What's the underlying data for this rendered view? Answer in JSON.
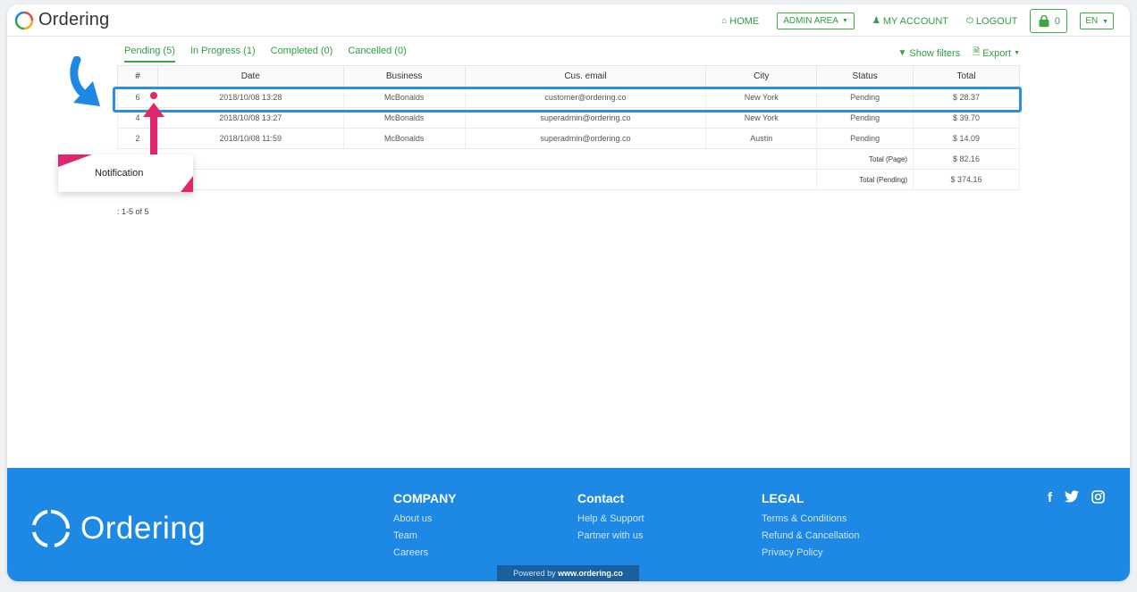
{
  "header": {
    "logo_text": "Ordering",
    "nav": {
      "home": "HOME",
      "admin_area": "ADMIN AREA",
      "my_account": "MY ACCOUNT",
      "logout": "LOGOUT",
      "cart_count": "0",
      "lang": "EN"
    }
  },
  "tabs": [
    {
      "label": "Pending (5)"
    },
    {
      "label": "In Progress (1)"
    },
    {
      "label": "Completed (0)"
    },
    {
      "label": "Cancelled (0)"
    }
  ],
  "tools": {
    "show_filters": "Show filters",
    "export": "Export"
  },
  "table": {
    "columns": [
      "#",
      "Date",
      "Business",
      "Cus. email",
      "City",
      "Status",
      "Total"
    ],
    "rows": [
      {
        "id": "6",
        "date": "2018/10/08 13:28",
        "business": "McBonalds",
        "email": "customer@ordering.co",
        "city": "New York",
        "status": "Pending",
        "total": "$ 28.37"
      },
      {
        "id": "4",
        "date": "2018/10/08 13:27",
        "business": "McBonalds",
        "email": "superadmin@ordering.co",
        "city": "New York",
        "status": "Pending",
        "total": "$ 39.70"
      },
      {
        "id": "2",
        "date": "2018/10/08 11:59",
        "business": "McBonalds",
        "email": "superadmin@ordering.co",
        "city": "Austin",
        "status": "Pending",
        "total": "$ 14.09"
      }
    ],
    "total_page_label": "Total (Page)",
    "total_page_value": "$ 82.16",
    "total_pending_label": "Total (Pending)",
    "total_pending_value": "$ 374.16"
  },
  "pager": ": 1-5 of 5",
  "annotation": {
    "label": "Notification"
  },
  "footer": {
    "logo_text": "Ordering",
    "company": {
      "title": "COMPANY",
      "links": [
        "About us",
        "Team",
        "Careers"
      ]
    },
    "contact": {
      "title": "Contact",
      "links": [
        "Help & Support",
        "Partner with us"
      ]
    },
    "legal": {
      "title": "LEGAL",
      "links": [
        "Terms & Conditions",
        "Refund & Cancellation",
        "Privacy Policy"
      ]
    },
    "social": [
      "facebook",
      "twitter",
      "instagram"
    ],
    "powered_prefix": "Powered by",
    "powered_site": "www.ordering.co"
  },
  "colors": {
    "brand_green": "#3aa845",
    "footer_blue": "#1e88e5",
    "highlight_blue": "#2d8fe0",
    "annotation_pink": "#e0266d"
  }
}
